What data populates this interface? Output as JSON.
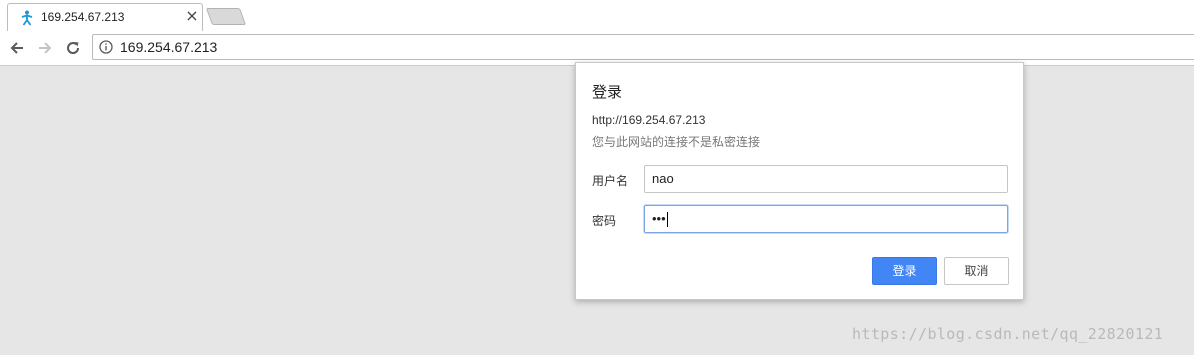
{
  "browser": {
    "tab": {
      "title": "169.254.67.213",
      "favicon": "person-tool-icon",
      "close": "×"
    },
    "toolbar": {
      "back": "back-arrow-icon",
      "forward": "forward-arrow-icon",
      "reload": "reload-icon",
      "omnibox_icon": "info-icon",
      "url": "169.254.67.213"
    }
  },
  "auth_dialog": {
    "title": "登录",
    "origin": "http://169.254.67.213",
    "warning": "您与此网站的连接不是私密连接",
    "username_label": "用户名",
    "username_value": "nao",
    "password_label": "密码",
    "password_masked": "•••",
    "login_button": "登录",
    "cancel_button": "取消"
  },
  "watermark": "https://blog.csdn.net/qq_22820121",
  "colors": {
    "accent": "#4285f4",
    "page_background": "#e6e6e6",
    "favicon": "#1a9ad6"
  }
}
